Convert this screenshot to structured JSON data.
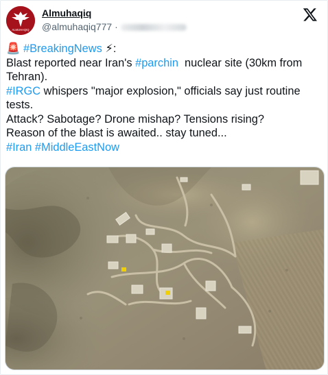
{
  "author": {
    "display_name": "Almuhaqiq",
    "handle": "@almuhaqiq777",
    "separator": "·",
    "avatar_text": "ALMUHAQIQ",
    "brand_color": "#a5121c"
  },
  "platform_icon": "x-logo-icon",
  "tweet": {
    "line1": {
      "siren": "🚨",
      "hashtag": "#BreakingNews",
      "bolt": "⚡",
      "suffix": ":"
    },
    "line2": {
      "pre": "Blast reported near Iran's ",
      "hashtag": "#parchin",
      "post": "  nuclear site (30km from Tehran)."
    },
    "line3": {
      "hashtag": "#IRGC",
      "post": " whispers \"major explosion,\" officials say just routine tests."
    },
    "line4": "Attack? Sabotage? Drone mishap? Tensions rising?",
    "line5": "Reason of the blast is awaited.. stay tuned...",
    "line6": {
      "hashtag1": "#Iran",
      "space": " ",
      "hashtag2": "#MiddleEastNow"
    }
  },
  "media": {
    "type": "satellite-image",
    "subject": "nuclear site aerial view"
  },
  "colors": {
    "link": "#1d9bf0",
    "text": "#0f1419",
    "muted": "#536471"
  }
}
